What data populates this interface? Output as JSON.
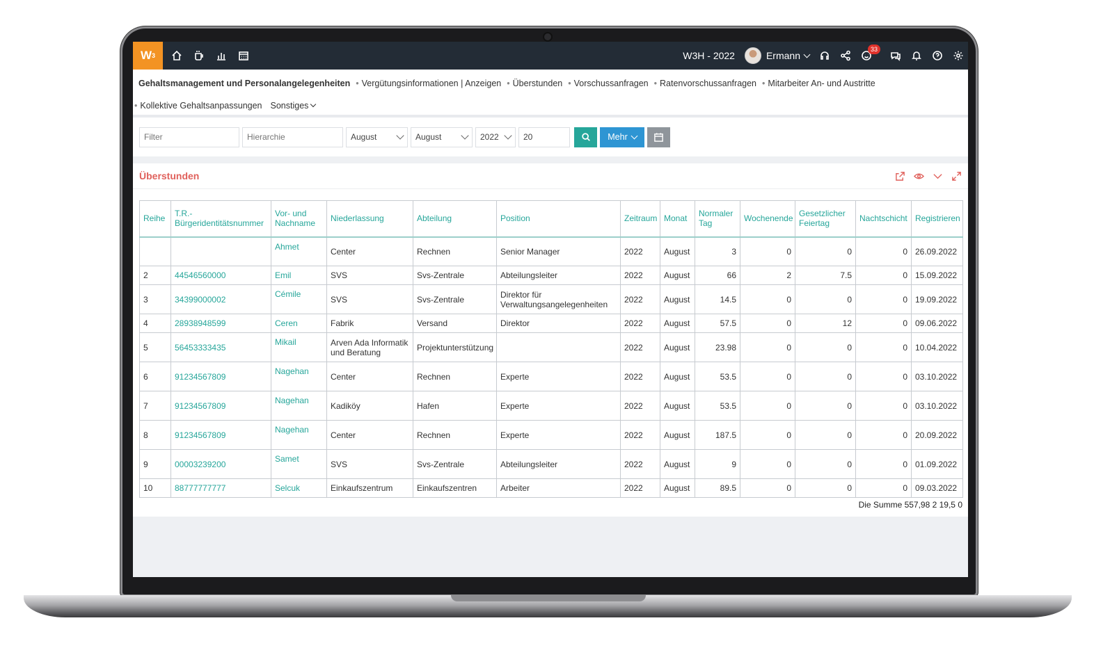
{
  "topbar": {
    "logo": "W",
    "logo_sup": "3",
    "app_title": "W3H - 2022",
    "user_name": "Ermann",
    "notification_count": "33"
  },
  "menu": {
    "row1": [
      "Gehaltsmanagement und Personalangelegenheiten",
      "Vergütungsinformationen | Anzeigen",
      "Überstunden",
      "Vorschussanfragen",
      "Ratenvorschussanfragen",
      "Mitarbeiter An- und Austritte"
    ],
    "row2": [
      "Kollektive Gehaltsanpassungen",
      "Sonstiges"
    ]
  },
  "filters": {
    "filter_placeholder": "Filter",
    "hierarchy_placeholder": "Hierarchie",
    "month_from": "August",
    "month_to": "August",
    "year": "2022",
    "page_size": "20",
    "more_label": "Mehr"
  },
  "panel": {
    "title": "Überstunden"
  },
  "table": {
    "headers": [
      "Reihe",
      "T.R.-Bürgeridentitätsnummer",
      "Vor- und Nachname",
      "Niederlassung",
      "Abteilung",
      "Position",
      "Zeitraum",
      "Monat",
      "Normaler Tag",
      "Wochenende",
      "Gesetzlicher Feiertag",
      "Nachtschicht",
      "Registrieren"
    ],
    "rows": [
      [
        "",
        "",
        "Ahmet",
        "Center",
        "Rechnen",
        "Senior Manager",
        "2022",
        "August",
        "3",
        "0",
        "0",
        "0",
        "26.09.2022"
      ],
      [
        "2",
        "44546560000",
        "Emil",
        "SVS",
        "Svs-Zentrale",
        "Abteilungsleiter",
        "2022",
        "August",
        "66",
        "2",
        "7.5",
        "0",
        "15.09.2022"
      ],
      [
        "3",
        "34399000002",
        "Cémile",
        "SVS",
        "Svs-Zentrale",
        "Direktor für Verwaltungsangelegenheiten",
        "2022",
        "August",
        "14.5",
        "0",
        "0",
        "0",
        "19.09.2022"
      ],
      [
        "4",
        "28938948599",
        "Ceren",
        "Fabrik",
        "Versand",
        "Direktor",
        "2022",
        "August",
        "57.5",
        "0",
        "12",
        "0",
        "09.06.2022"
      ],
      [
        "5",
        "56453333435",
        "Mikail",
        "Arven Ada Informatik und Beratung",
        "Projektunterstützung",
        "",
        "2022",
        "August",
        "23.98",
        "0",
        "0",
        "0",
        "10.04.2022"
      ],
      [
        "6",
        "91234567809",
        "Nagehan",
        "Center",
        "Rechnen",
        "Experte",
        "2022",
        "August",
        "53.5",
        "0",
        "0",
        "0",
        "03.10.2022"
      ],
      [
        "7",
        "91234567809",
        "Nagehan",
        "Kadiköy",
        "Hafen",
        "Experte",
        "2022",
        "August",
        "53.5",
        "0",
        "0",
        "0",
        "03.10.2022"
      ],
      [
        "8",
        "91234567809",
        "Nagehan",
        "Center",
        "Rechnen",
        "Experte",
        "2022",
        "August",
        "187.5",
        "0",
        "0",
        "0",
        "20.09.2022"
      ],
      [
        "9",
        "00003239200",
        "Samet",
        "SVS",
        "Svs-Zentrale",
        "Abteilungsleiter",
        "2022",
        "August",
        "9",
        "0",
        "0",
        "0",
        "01.09.2022"
      ],
      [
        "10",
        "88777777777",
        "Selcuk",
        "Einkaufszentrum",
        "Einkaufszentren",
        "Arbeiter",
        "2022",
        "August",
        "89.5",
        "0",
        "0",
        "0",
        "09.03.2022"
      ]
    ],
    "sum_label": "Die Summe 557,98 2 19,5 0"
  },
  "colors": {
    "topbar": "#232c36",
    "logo": "#f39323",
    "accent_teal": "#26a69a",
    "accent_blue": "#2e95d3",
    "panel_title": "#e0615c"
  }
}
